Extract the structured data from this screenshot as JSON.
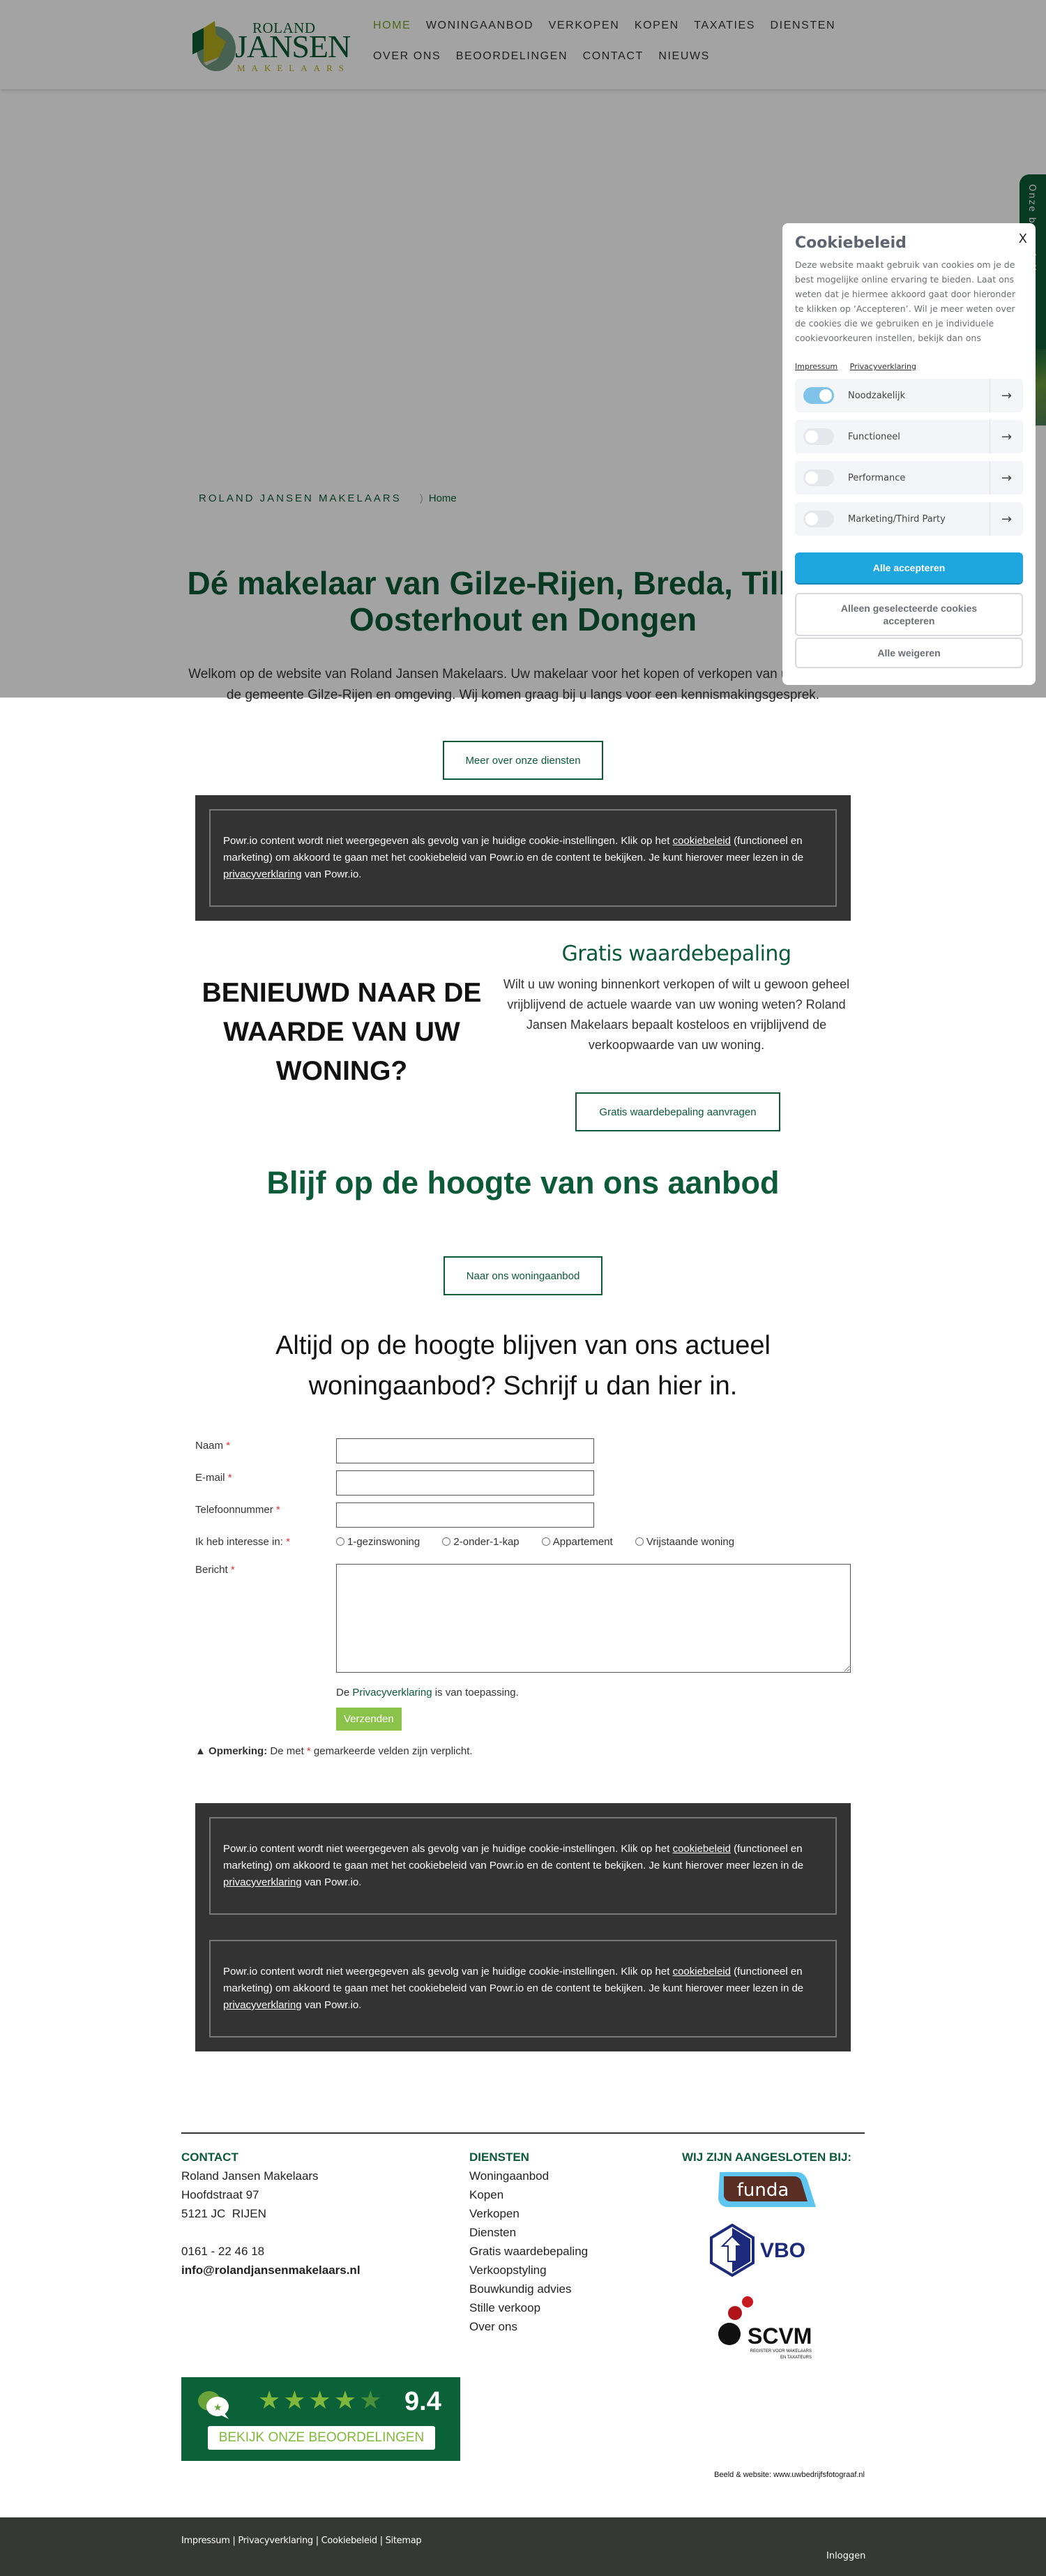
{
  "header": {
    "logo": {
      "line1": "ROLAND",
      "line2": "JANSEN",
      "line3": "MAKELAARS"
    },
    "nav": [
      {
        "label": "HOME",
        "active": true
      },
      {
        "label": "WONINGAANBOD"
      },
      {
        "label": "VERKOPEN"
      },
      {
        "label": "KOPEN"
      },
      {
        "label": "TAXATIES"
      },
      {
        "label": "DIENSTEN"
      },
      {
        "label": "OVER ONS"
      },
      {
        "label": "BEOORDELINGEN"
      },
      {
        "label": "CONTACT"
      },
      {
        "label": "NIEUWS"
      }
    ]
  },
  "side_tab": {
    "label": "Onze beoordelingen"
  },
  "hero": {
    "breadcrumb_site": "ROLAND JANSEN MAKELAARS",
    "breadcrumb_sep": ")",
    "breadcrumb_home": "Home",
    "title": "Dé makelaar van Gilze-Rijen, Breda, Tilburg, Oosterhout en Dongen",
    "text": "Welkom op de website van Roland Jansen Makelaars. Uw makelaar voor het kopen of verkopen van uw woning in de gemeente Gilze-Rijen en omgeving. Wij komen graag bij u langs voor een kennismakingsgesprek.",
    "button": "Meer over onze diensten"
  },
  "cookie_panel": {
    "title": "Cookiebeleid",
    "close": "X",
    "text": "Deze website maakt gebruik van cookies om je de best mogelijke online ervaring te bieden. Laat ons weten dat je hiermee akkoord gaat door hieronder te klikken op ‘Accepteren’. Wil je meer weten over de cookies die we gebruiken en je individuele cookievoorkeuren instellen, bekijk dan ons",
    "links": [
      "Impressum",
      "Privacyverklaring"
    ],
    "categories": [
      {
        "label": "Noodzakelijk",
        "enabled": true
      },
      {
        "label": "Functioneel",
        "enabled": false
      },
      {
        "label": "Performance",
        "enabled": false
      },
      {
        "label": "Marketing/Third Party",
        "enabled": false
      }
    ],
    "accept_all": "Alle accepteren",
    "accept_selected": "Alleen geselecteerde cookies accepteren",
    "reject_all": "Alle weigeren",
    "arrow": "→"
  },
  "powr_notice": {
    "part1": "Powr.io content wordt niet weergegeven als gevolg van je huidige cookie-instellingen. Klik op het ",
    "link1": "cookiebeleid",
    "part2": " (functioneel en marketing) om akkoord te gaan met het cookiebeleid van Powr.io en de content te bekijken. Je kunt hierover meer lezen in de ",
    "link2": "privacyverklaring",
    "part3": " van Powr.io."
  },
  "valuation": {
    "left_heading": "BENIEUWD NAAR DE WAARDE VAN UW WONING?",
    "title": "Gratis waardebepaling",
    "text": "Wilt u uw woning binnenkort verkopen of wilt u gewoon geheel vrijblijvend de actuele waarde van uw woning weten? Roland Jansen Makelaars bepaalt kosteloos en vrijblijvend de verkoopwaarde van uw woning.",
    "button": "Gratis waardebepaling aanvragen"
  },
  "aanbod": {
    "title": "Blijf op de hoogte van ons aanbod",
    "button": "Naar ons woningaanbod",
    "subtitle": "Altijd op de hoogte blijven van ons actueel woningaanbod? Schrijf u dan hier in."
  },
  "form": {
    "fields": [
      {
        "label": "Naam",
        "value": ""
      },
      {
        "label": "E-mail",
        "value": ""
      },
      {
        "label": "Telefoonnummer",
        "value": ""
      }
    ],
    "interest_label": "Ik heb interesse in:",
    "interest_options": [
      "1-gezinswoning",
      "2-onder-1-kap",
      "Appartement",
      "Vrijstaande woning"
    ],
    "message_label": "Bericht",
    "message_value": "",
    "required_mark": "*",
    "privacy_pre": "De ",
    "privacy_link": "Privacyverklaring",
    "privacy_post": " is van toepassing.",
    "submit": "Verzenden",
    "remark_bold": "Opmerking:",
    "remark_pre": " De met ",
    "remark_post": " gemarkeerde velden zijn verplicht."
  },
  "footer": {
    "contact": {
      "title": "CONTACT",
      "company": "Roland Jansen Makelaars",
      "street": "Hoofdstraat 97",
      "city": "5121 JC  RIJEN",
      "phone": "0161 - 22 46 18",
      "email": "info@rolandjansenmakelaars.nl"
    },
    "services": {
      "title": "DIENSTEN",
      "items": [
        "Woningaanbod",
        "Kopen",
        "Verkopen",
        "Diensten",
        "Gratis waardebepaling",
        "Verkoopstyling",
        "Bouwkundig advies",
        "Stille verkoop",
        "Over ons"
      ]
    },
    "affiliations": {
      "title": "WIJ ZIJN AANGESLOTEN BIJ:",
      "logos": [
        "funda",
        "VBO",
        "SCVM"
      ],
      "scvm_sub1": "REGISTER VOOR MAKELAARS",
      "scvm_sub2": "EN TAXATEURS"
    },
    "review_badge": {
      "rating": "9.4",
      "stars": 4.5,
      "cta": "BEKIJK ONZE BEOORDELINGEN"
    },
    "credit": "Beeld & website: www.uwbedrijfsfotograaf.nl"
  },
  "bottom_bar": {
    "links": [
      "Impressum",
      "Privacyverklaring",
      "Cookiebeleid",
      "Sitemap"
    ],
    "separator": " | ",
    "login": "Inloggen"
  },
  "colors": {
    "brand_green": "#0b5a38",
    "accent_lime": "#8bc34a",
    "cookie_blue": "#1ea6df",
    "dark_box": "#333333"
  }
}
